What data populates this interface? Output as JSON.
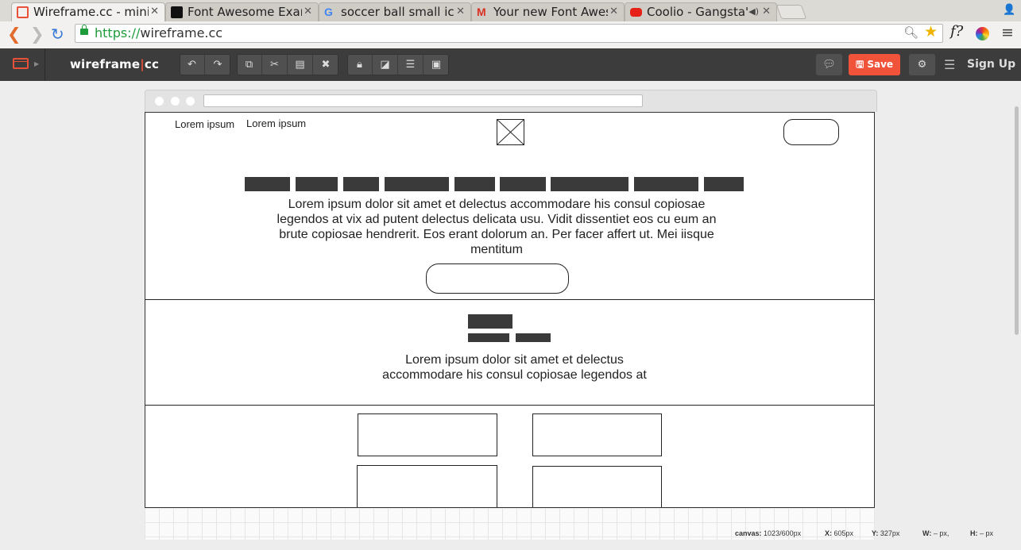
{
  "browser": {
    "tabs": [
      {
        "title": "Wireframe.cc - minim",
        "favicon": "wireframe-favicon",
        "color": "#e8503a",
        "active": true
      },
      {
        "title": "Font Awesome Exam",
        "favicon": "font-awesome-favicon",
        "color": "#222222"
      },
      {
        "title": "soccer ball small icor",
        "favicon": "google-favicon",
        "color": "#4285f4"
      },
      {
        "title": "Your new Font Awes",
        "favicon": "gmail-favicon",
        "color": "#d93025"
      },
      {
        "title": "Coolio - Gangsta's",
        "favicon": "youtube-favicon",
        "color": "#e62117",
        "audio": true
      }
    ],
    "url_scheme": "https://",
    "url_host": "wireframe.cc",
    "extension_label": "f?"
  },
  "app": {
    "brand_left": "wireframe",
    "brand_sep": "|",
    "brand_right": "cc",
    "save_label": "Save",
    "signup_label": "Sign Up",
    "accent": "#f0533a"
  },
  "wireframe": {
    "nav_links": [
      "Lorem ipsum",
      "Lorem ipsum"
    ],
    "hero_text": "Lorem ipsum dolor sit amet et delectus accommodare his consul copiosae legendos at vix ad putent delectus delicata usu. Vidit dissentiet eos cu eum an brute copiosae hendrerit. Eos erant dolorum an. Per facer affert ut. Mei iisque mentitum",
    "section_text": "Lorem ipsum dolor sit amet et delectus accommodare his consul copiosae legendos at"
  },
  "status": {
    "canvas_label": "canvas:",
    "canvas_value": "1023/600px",
    "x_label": "X:",
    "x_value": "605px",
    "y_label": "Y:",
    "y_value": "327px",
    "w_label": "W:",
    "w_value": "– px,",
    "h_label": "H:",
    "h_value": "– px"
  }
}
